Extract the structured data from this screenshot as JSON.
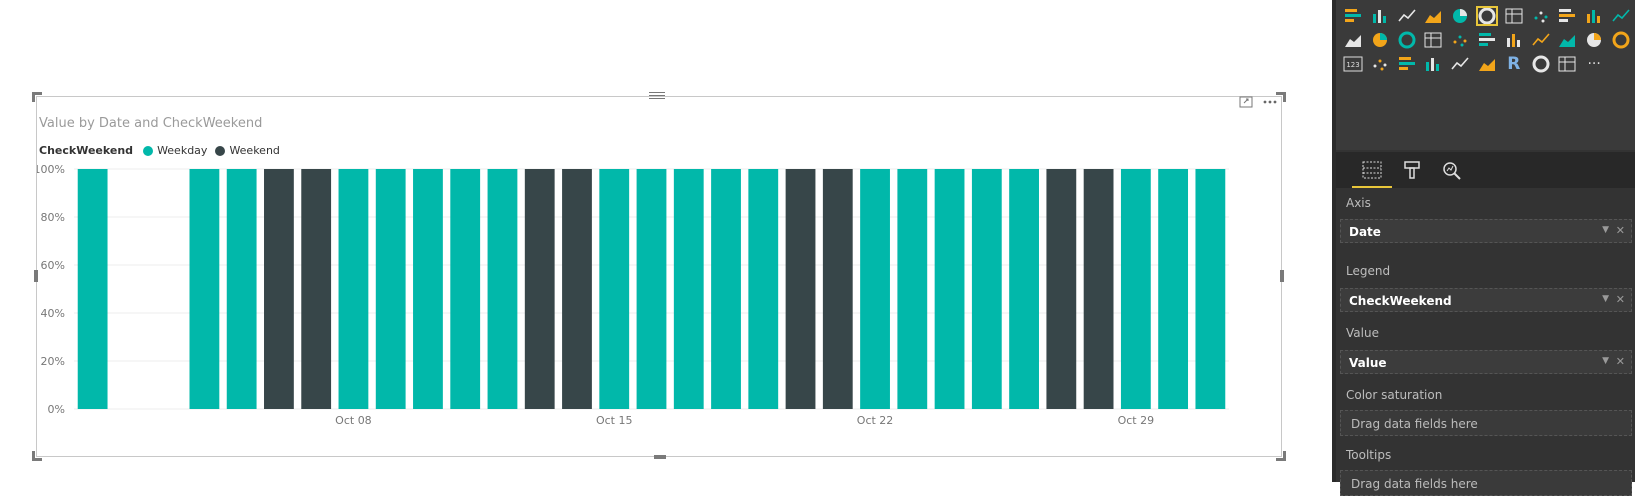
{
  "visual": {
    "title": "Value by Date and CheckWeekend",
    "legend_title": "CheckWeekend",
    "legend_items": [
      {
        "label": "Weekday",
        "color": "#01b8aa"
      },
      {
        "label": "Weekend",
        "color": "#374649"
      }
    ],
    "header_icons": [
      "focus-mode-icon",
      "more-options-icon"
    ]
  },
  "chart_data": {
    "type": "bar",
    "stacked": "100%",
    "ylabel_ticks": [
      "0%",
      "20%",
      "40%",
      "60%",
      "80%",
      "100%"
    ],
    "ylim": [
      0,
      100
    ],
    "x_tick_labels": [
      "Oct 08",
      "Oct 15",
      "Oct 22",
      "Oct 29"
    ],
    "categories": [
      "Oct 01",
      "Oct 02",
      "Oct 03",
      "Oct 04",
      "Oct 05",
      "Oct 06",
      "Oct 07",
      "Oct 08",
      "Oct 09",
      "Oct 10",
      "Oct 11",
      "Oct 12",
      "Oct 13",
      "Oct 14",
      "Oct 15",
      "Oct 16",
      "Oct 17",
      "Oct 18",
      "Oct 19",
      "Oct 20",
      "Oct 21",
      "Oct 22",
      "Oct 23",
      "Oct 24",
      "Oct 25",
      "Oct 26",
      "Oct 27",
      "Oct 28",
      "Oct 29",
      "Oct 30",
      "Oct 31"
    ],
    "series": [
      {
        "name": "Weekday",
        "color": "#01b8aa",
        "values": [
          100,
          0,
          0,
          100,
          100,
          0,
          0,
          100,
          100,
          100,
          100,
          100,
          0,
          0,
          100,
          100,
          100,
          100,
          100,
          0,
          0,
          100,
          100,
          100,
          100,
          100,
          0,
          0,
          100,
          100,
          100
        ]
      },
      {
        "name": "Weekend",
        "color": "#374649",
        "values": [
          0,
          0,
          0,
          0,
          0,
          100,
          100,
          0,
          0,
          0,
          0,
          0,
          100,
          100,
          0,
          0,
          0,
          0,
          0,
          100,
          100,
          0,
          0,
          0,
          0,
          0,
          100,
          100,
          0,
          0,
          0
        ]
      }
    ],
    "grid": true,
    "legend": "top-left"
  },
  "panel": {
    "viz_icons": [
      "stacked-bar-icon",
      "stacked-column-icon",
      "clustered-bar-icon",
      "clustered-column-icon",
      "100-stacked-bar-icon",
      "100-stacked-column-icon",
      "line-chart-icon",
      "area-chart-icon",
      "stacked-area-icon",
      "line-stacked-column-icon",
      "line-clustered-column-icon",
      "ribbon-chart-icon",
      "waterfall-icon",
      "scatter-icon",
      "pie-icon",
      "donut-icon",
      "treemap-icon",
      "map-icon",
      "filled-map-icon",
      "shape-map-icon",
      "funnel-icon",
      "gauge-icon",
      "card-icon",
      "multirow-card-icon",
      "kpi-icon",
      "slicer-icon",
      "table-icon",
      "matrix-icon",
      "r-visual-icon",
      "arcgis-icon",
      "custom-visual-icon",
      "more-visuals-icon"
    ],
    "selected_viz": 5,
    "tabs": [
      "fields-tab-icon",
      "format-tab-icon",
      "analytics-tab-icon"
    ],
    "wells": [
      {
        "label": "Axis",
        "field": "Date"
      },
      {
        "label": "Legend",
        "field": "CheckWeekend"
      },
      {
        "label": "Value",
        "field": "Value"
      },
      {
        "label": "Color saturation",
        "placeholder": "Drag data fields here"
      },
      {
        "label": "Tooltips",
        "placeholder": "Drag data fields here"
      }
    ]
  }
}
